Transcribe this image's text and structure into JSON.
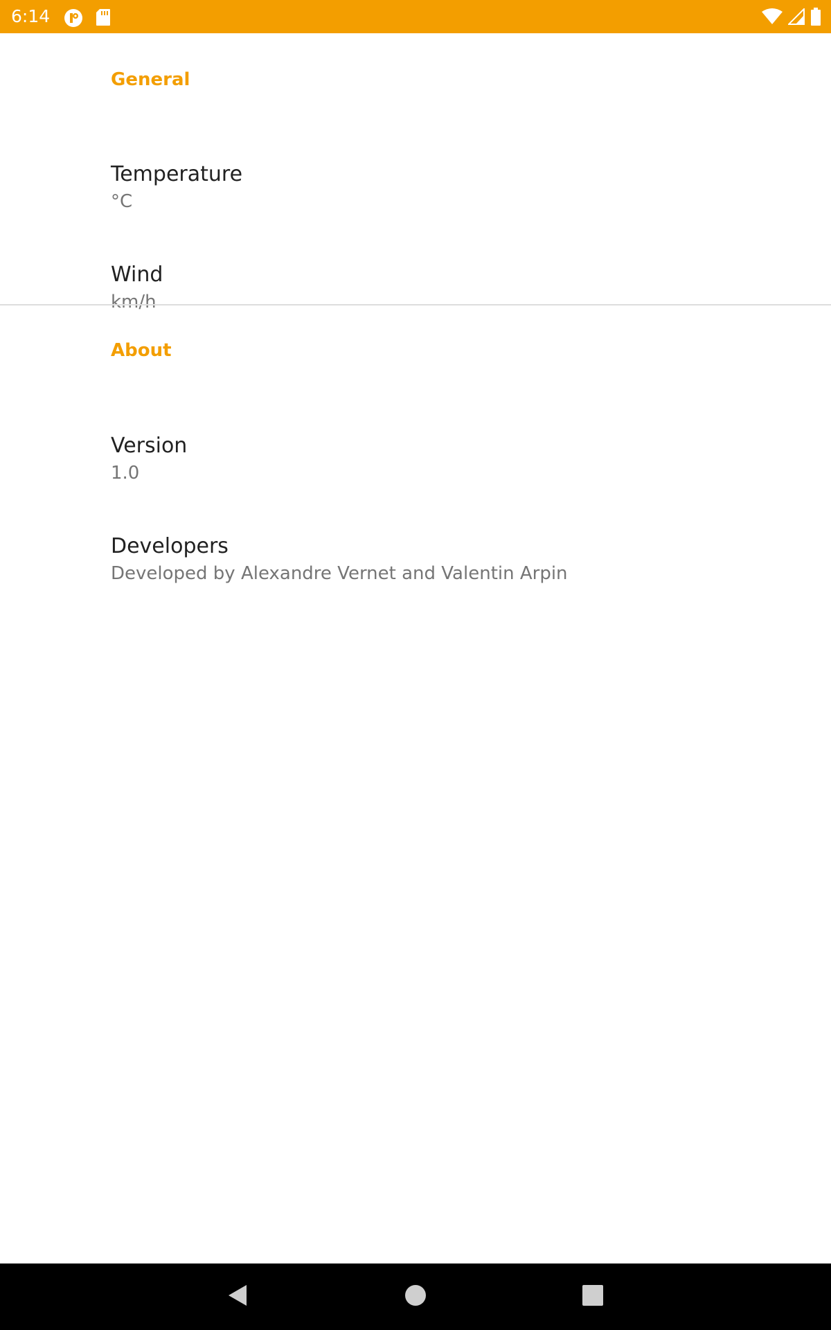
{
  "status_bar": {
    "time": "6:14",
    "left_icons": [
      "p-app-icon",
      "sd-card-icon"
    ],
    "right_icons": [
      "wifi-icon",
      "cell-signal-icon",
      "battery-icon"
    ],
    "background_color": "#F39E00"
  },
  "settings": {
    "accent_color": "#F39E00",
    "general": {
      "header": "General",
      "temperature": {
        "title": "Temperature",
        "summary": "°C"
      },
      "wind": {
        "title": "Wind",
        "summary": "km/h"
      }
    },
    "about": {
      "header": "About",
      "version": {
        "title": "Version",
        "summary": "1.0"
      },
      "developers": {
        "title": "Developers",
        "summary": "Developed by Alexandre Vernet and Valentin Arpin"
      }
    }
  },
  "nav_bar": {
    "buttons": [
      "back-icon",
      "home-icon",
      "recents-icon"
    ]
  }
}
